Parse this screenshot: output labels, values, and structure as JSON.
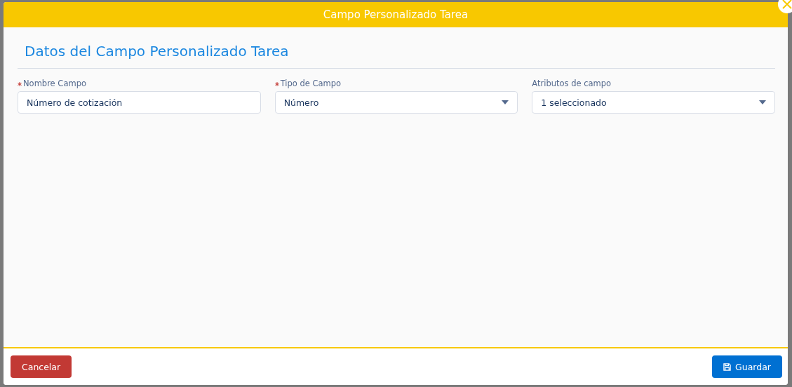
{
  "modal": {
    "title": "Campo Personalizado Tarea",
    "section_title": "Datos del Campo Personalizado Tarea",
    "fields": [
      {
        "kind": "text",
        "label": "Nombre Campo",
        "required": true,
        "value": "Número de cotización"
      },
      {
        "kind": "select",
        "label": "Tipo de Campo",
        "required": true,
        "value": "Número"
      },
      {
        "kind": "select",
        "label": "Atributos de campo",
        "required": false,
        "value": "1 seleccionado"
      }
    ],
    "buttons": [
      {
        "kind": "cancel",
        "label": "Cancelar"
      },
      {
        "kind": "save",
        "label": "Guardar"
      }
    ]
  }
}
